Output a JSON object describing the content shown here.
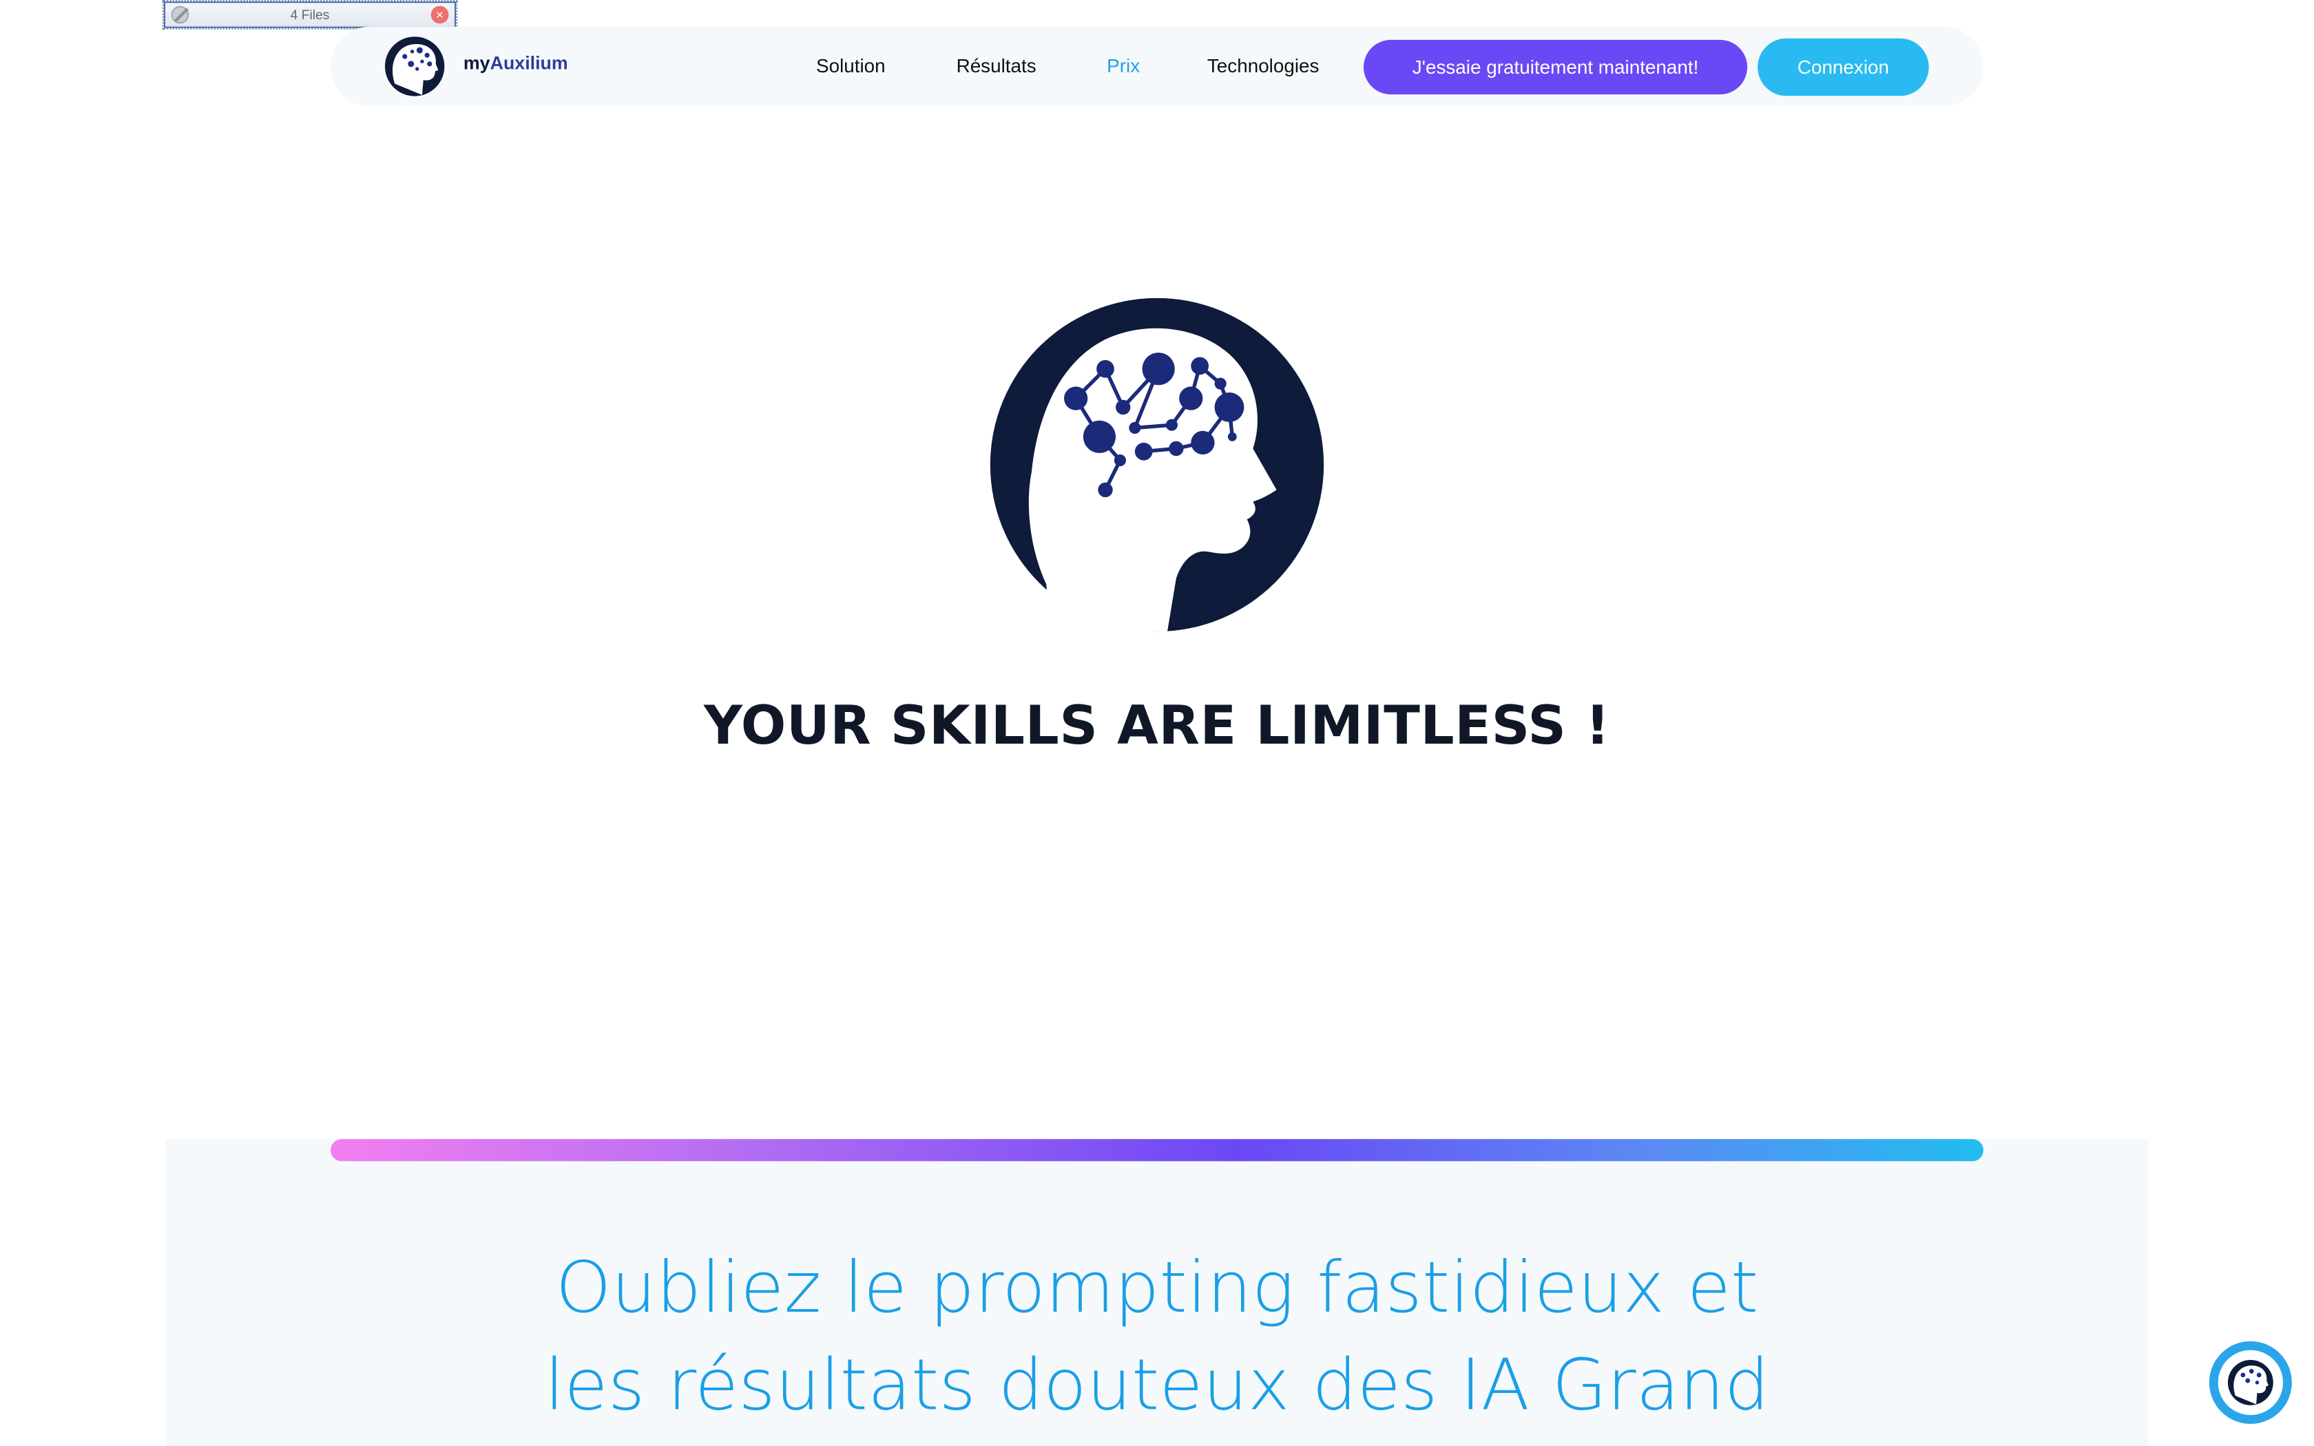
{
  "file_widget": {
    "label": "4 Files",
    "icon": "ban-icon",
    "close_icon": "close-icon"
  },
  "brand": {
    "prefix": "my",
    "highlight": "Auxilium",
    "logo": "brain-head-icon"
  },
  "nav": {
    "links": [
      {
        "label": "Solution",
        "active": false
      },
      {
        "label": "Résultats",
        "active": false
      },
      {
        "label": "Prix",
        "active": true
      },
      {
        "label": "Technologies",
        "active": false
      }
    ],
    "cta_label": "J'essaie gratuitement maintenant!",
    "login_label": "Connexion"
  },
  "hero": {
    "logo": "brain-head-icon",
    "tagline": "YOUR SKILLS ARE LIMITLESS !"
  },
  "section": {
    "headline_line1": "Oubliez le prompting fastidieux et",
    "headline_line2": "les résultats douteux des IA Grand"
  },
  "chat_widget": {
    "icon": "brain-head-icon"
  },
  "colors": {
    "brand_dark": "#0f1b3a",
    "accent_purple": "#6b48f5",
    "accent_blue": "#28baf0",
    "headline_blue": "#1a9fe6",
    "gradient": [
      "#f27ff0",
      "#b36df2",
      "#6b48f5",
      "#5a8bf3",
      "#21bdf0"
    ]
  }
}
